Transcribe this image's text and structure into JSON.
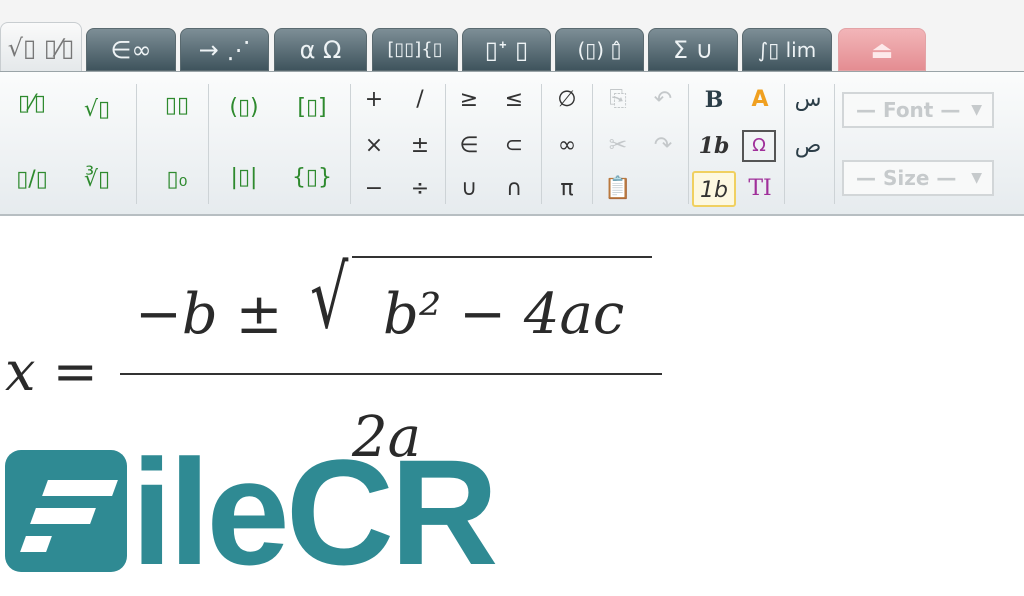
{
  "tabs": [
    {
      "label": "√▯ ▯⁄▯"
    },
    {
      "label": "∈∞"
    },
    {
      "label": "→ ⋰"
    },
    {
      "label": "α Ω"
    },
    {
      "label": "[▯▯]{▯"
    },
    {
      "label": "▯ᐩ ▯"
    },
    {
      "label": "(▯) ▯̂"
    },
    {
      "label": "Σ ∪"
    },
    {
      "label": "∫▯ lim"
    },
    {
      "label": "⏏"
    }
  ],
  "toolbar": {
    "templates": [
      "▯⁄▯",
      "√▯",
      "▯▯",
      "▯/▯",
      "∛▯",
      "▯₀",
      "(▯)",
      "[▯]",
      "|▯|",
      "{▯}"
    ],
    "operators": [
      "+",
      "/",
      "×",
      "±",
      "−",
      "÷"
    ],
    "relations": [
      "≥",
      "≤",
      "∈",
      "⊂",
      "∪",
      "∩"
    ],
    "symbols": [
      "∅",
      "∞",
      "π"
    ],
    "edit": [
      "copy",
      "undo",
      "cut",
      "redo",
      "paste"
    ],
    "style": [
      "B",
      "A",
      "1b",
      "Ω",
      "1b",
      "TI"
    ],
    "rtl": [
      "س",
      "ص"
    ],
    "font_placeholder": "— Font —",
    "size_placeholder": "— Size —"
  },
  "formula": {
    "lhs": "x =",
    "numerator": "−b ± ",
    "radicand": "b² − 4ac",
    "denominator": "2a"
  },
  "watermark": "FileCR",
  "colors": {
    "tab": "#4f646c",
    "accent_green": "#2e8a2e",
    "watermark": "#2f8a93"
  }
}
